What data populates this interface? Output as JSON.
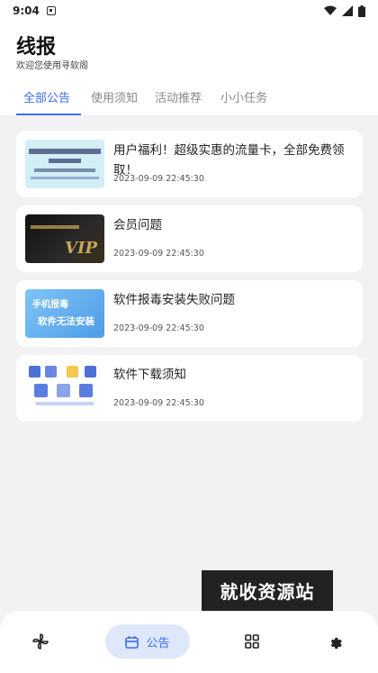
{
  "status": {
    "time": "9:04"
  },
  "header": {
    "title": "线报",
    "subtitle": "欢迎您使用寻软阁"
  },
  "tabs": [
    {
      "label": "全部公告",
      "active": true
    },
    {
      "label": "使用须知",
      "active": false
    },
    {
      "label": "活动推荐",
      "active": false
    },
    {
      "label": "小小任务",
      "active": false
    }
  ],
  "posts": [
    {
      "title": "用户福利！超级实惠的流量卡，全部免费领取！",
      "date": "2023-09-09 22:45:30",
      "thumb": "sim-card-promo"
    },
    {
      "title": "会员问题",
      "date": "2023-09-09 22:45:30",
      "thumb": "vip-badge",
      "thumb_text": "VIP"
    },
    {
      "title": "软件报毒安装失败问题",
      "date": "2023-09-09 22:45:30",
      "thumb": "install-failed-banner",
      "thumb_text": [
        "手机报毒",
        "软件无法安装"
      ]
    },
    {
      "title": "软件下载须知",
      "date": "2023-09-09 22:45:30",
      "thumb": "app-icons-grid"
    }
  ],
  "watermark": "就收资源站",
  "bottom_nav": {
    "items": [
      {
        "icon": "pinwheel-icon"
      },
      {
        "icon": "calendar-icon",
        "label": "公告",
        "active": true
      },
      {
        "icon": "grid-icon"
      },
      {
        "icon": "gear-icon"
      }
    ]
  },
  "colors": {
    "accent": "#3a6df0",
    "background": "#f2f2f4"
  }
}
